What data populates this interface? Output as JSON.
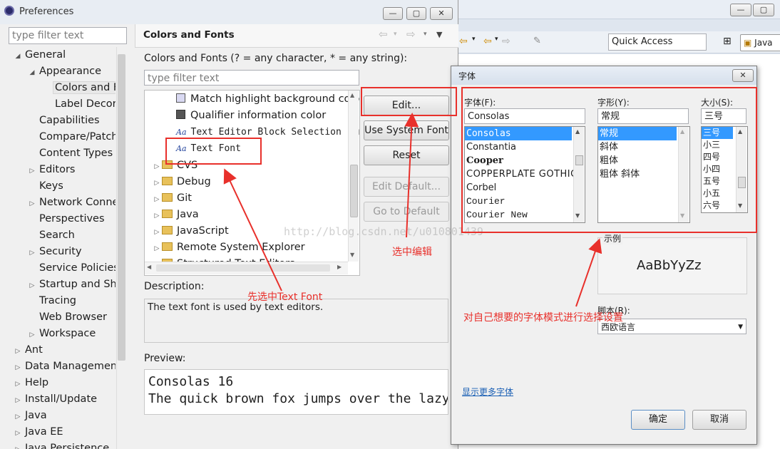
{
  "prefs": {
    "title": "Preferences",
    "filter_placeholder": "type filter text",
    "tree": [
      {
        "label": "General",
        "level": 0,
        "exp": "open"
      },
      {
        "label": "Appearance",
        "level": 1,
        "exp": "open"
      },
      {
        "label": "Colors and Fonts",
        "level": 2,
        "exp": "",
        "selected": true
      },
      {
        "label": "Label Decorations",
        "level": 2,
        "exp": ""
      },
      {
        "label": "Capabilities",
        "level": 1,
        "exp": ""
      },
      {
        "label": "Compare/Patch",
        "level": 1,
        "exp": ""
      },
      {
        "label": "Content Types",
        "level": 1,
        "exp": ""
      },
      {
        "label": "Editors",
        "level": 1,
        "exp": "closed"
      },
      {
        "label": "Keys",
        "level": 1,
        "exp": ""
      },
      {
        "label": "Network Connections",
        "level": 1,
        "exp": "closed"
      },
      {
        "label": "Perspectives",
        "level": 1,
        "exp": ""
      },
      {
        "label": "Search",
        "level": 1,
        "exp": ""
      },
      {
        "label": "Security",
        "level": 1,
        "exp": "closed"
      },
      {
        "label": "Service Policies",
        "level": 1,
        "exp": ""
      },
      {
        "label": "Startup and Shutdown",
        "level": 1,
        "exp": "closed"
      },
      {
        "label": "Tracing",
        "level": 1,
        "exp": ""
      },
      {
        "label": "Web Browser",
        "level": 1,
        "exp": ""
      },
      {
        "label": "Workspace",
        "level": 1,
        "exp": "closed"
      },
      {
        "label": "Ant",
        "level": 0,
        "exp": "closed"
      },
      {
        "label": "Data Management",
        "level": 0,
        "exp": "closed"
      },
      {
        "label": "Help",
        "level": 0,
        "exp": "closed"
      },
      {
        "label": "Install/Update",
        "level": 0,
        "exp": "closed"
      },
      {
        "label": "Java",
        "level": 0,
        "exp": "closed"
      },
      {
        "label": "Java EE",
        "level": 0,
        "exp": "closed"
      },
      {
        "label": "Java Persistence",
        "level": 0,
        "exp": "closed"
      }
    ],
    "page_title": "Colors and Fonts",
    "hint": "Colors and Fonts (? = any character, * = any string):",
    "inner_filter_placeholder": "type filter text",
    "color_items": [
      {
        "label": "Match highlight background color",
        "icon": "swatch-light"
      },
      {
        "label": "Qualifier information color",
        "icon": "swatch-dark"
      },
      {
        "label": "Text Editor Block Selection Font",
        "icon": "font",
        "mono": true
      },
      {
        "label": "Text Font",
        "icon": "font",
        "mono": true,
        "boxed": true
      }
    ],
    "categories": [
      "CVS",
      "Debug",
      "Git",
      "Java",
      "JavaScript",
      "Remote System Explorer",
      "Structured Text Editors"
    ],
    "buttons": {
      "edit": "Edit...",
      "system_font": "Use System Font",
      "reset": "Reset",
      "edit_default": "Edit Default...",
      "go_default": "Go to Default"
    },
    "description_label": "Description:",
    "description": "The text font is used by text editors.",
    "preview_label": "Preview:",
    "preview_lines": [
      "Consolas 16",
      "The quick brown fox jumps over the lazy dog."
    ]
  },
  "ide": {
    "quick_access": "Quick Access",
    "perspective": "Java"
  },
  "font_dialog": {
    "title": "字体",
    "font_label": "字体(F):",
    "font_value": "Consolas",
    "fonts": [
      "Consolas",
      "Constantia",
      "Cooper",
      "COPPERPLATE GOTHIC",
      "Corbel",
      "Courier",
      "Courier New"
    ],
    "style_label": "字形(Y):",
    "style_value": "常规",
    "styles": [
      "常规",
      "斜体",
      "粗体",
      "粗体 斜体"
    ],
    "size_label": "大小(S):",
    "size_value": "三号",
    "sizes": [
      "三号",
      "小三",
      "四号",
      "小四",
      "五号",
      "小五",
      "六号"
    ],
    "sample_label": "示例",
    "sample_text": "AaBbYyZz",
    "script_label": "脚本(R):",
    "script_value": "西欧语言",
    "more_fonts": "显示更多字体",
    "ok": "确定",
    "cancel": "取消"
  },
  "annotations": {
    "select_text_font": "先选中Text Font",
    "select_edit": "选中编辑",
    "choose_font": "对自己想要的字体模式进行选择设置"
  },
  "watermark": "http://blog.csdn.net/u010801439",
  "colors": {
    "annotation_red": "#e8302b",
    "selection_blue": "#3399ff",
    "link_blue": "#1a5fb4"
  }
}
